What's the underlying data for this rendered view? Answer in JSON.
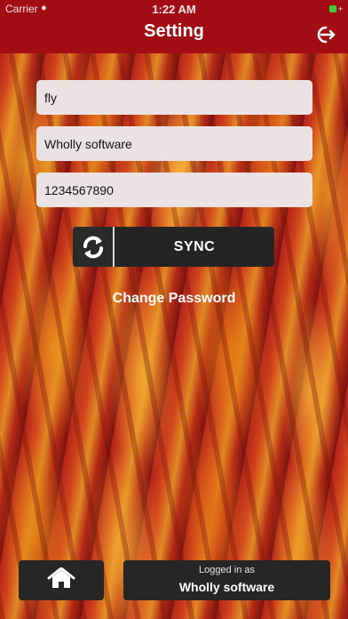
{
  "status_bar": {
    "carrier": "Carrier",
    "time": "1:22 AM"
  },
  "header": {
    "title": "Setting",
    "logout_icon": "logout-icon"
  },
  "form": {
    "field1_value": "fly",
    "field2_value": "Wholly software",
    "field3_value": "1234567890"
  },
  "sync": {
    "icon": "sync-icon",
    "label": "SYNC"
  },
  "change_password_label": "Change Password",
  "footer": {
    "home_icon": "home-icon",
    "logged_in_caption": "Logged in as",
    "logged_in_user": "Wholly software"
  },
  "colors": {
    "header_bg": "#a10d13",
    "button_bg": "#262626",
    "field_bg": "#ebe3e3"
  }
}
